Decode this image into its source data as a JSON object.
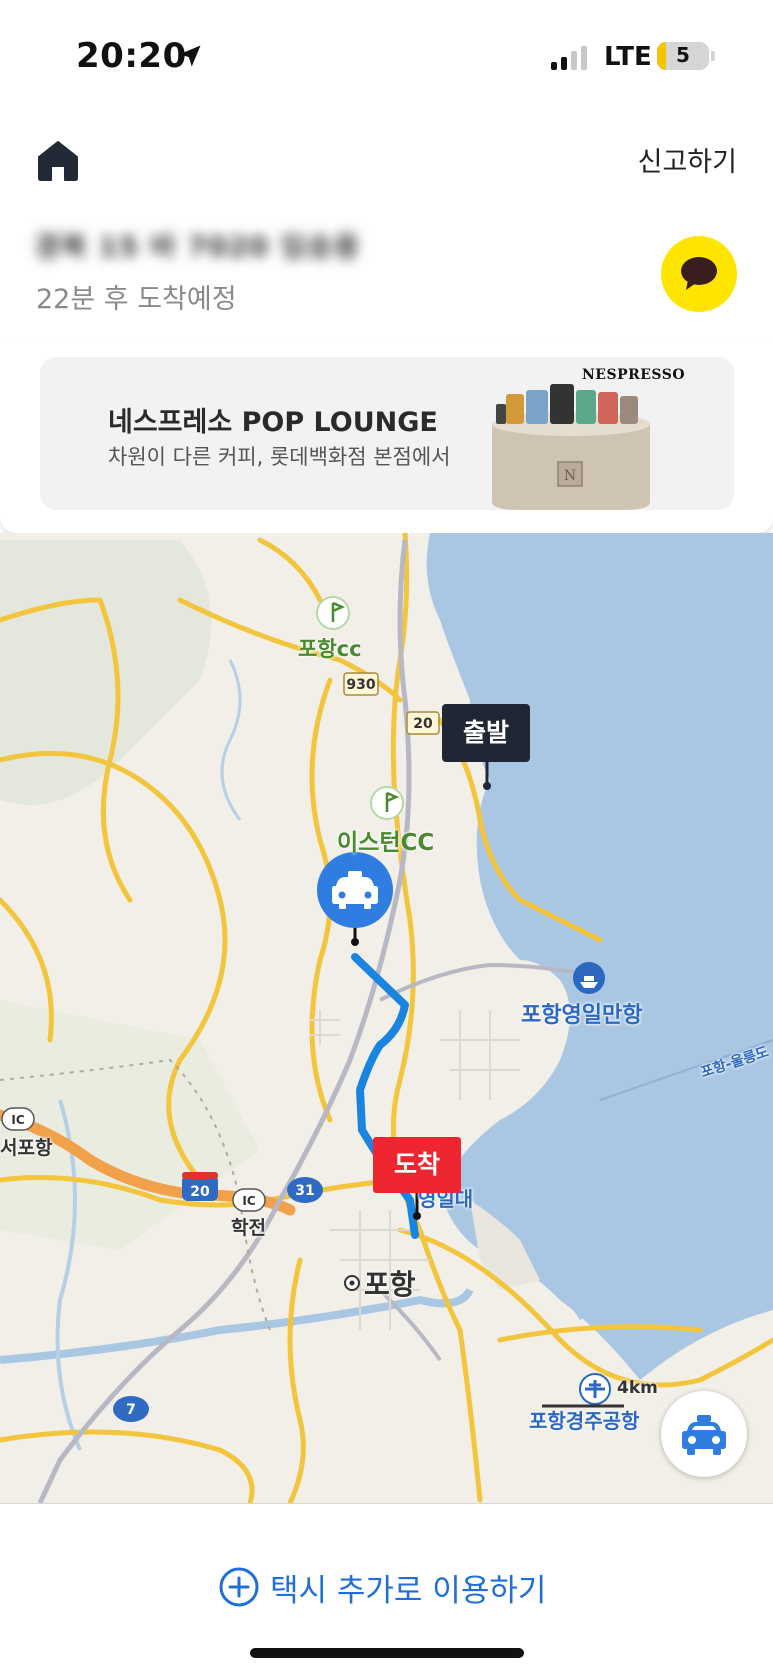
{
  "status_bar": {
    "time": "20:20",
    "network": "LTE",
    "battery": "5",
    "icons": [
      "location-arrow-icon",
      "signal-icon",
      "battery-icon"
    ]
  },
  "header": {
    "home_icon": "home-icon",
    "report_label": "신고하기",
    "car_info_blurred": "경북 15 바 7020 임승용",
    "eta_text": "22분 후 도착예정",
    "chat_icon": "kakao-chat-icon"
  },
  "ad": {
    "title": "네스프레소 POP LOUNGE",
    "subtitle": "차원이 다른 커피, 롯데백화점 본점에서",
    "brand": "NESPRESSO"
  },
  "map": {
    "labels": {
      "pohang_cc": "포항cc",
      "eastern_cc": "이스턴CC",
      "yeongil_port": "포항영일만항",
      "pohang": "포항",
      "seopohang": "서포항",
      "hakjeon": "학전",
      "airport": "포항경주공항",
      "route_text": "포항-울릉도",
      "yeongildae": "영일대",
      "scale": "4km"
    },
    "road_numbers": {
      "r930": "930",
      "r20": "20",
      "r20_highway": "20",
      "r31": "31",
      "r7": "7",
      "ic": "IC"
    },
    "start_marker": "출발",
    "end_marker": "도착",
    "colors": {
      "route": "#1a85e0",
      "start_marker": "#1f2634",
      "end_marker": "#ee2631",
      "sea": "#a9c7e3",
      "taxi_pin": "#2f7de1"
    }
  },
  "bottom": {
    "add_taxi_label": "택시 추가로 이용하기",
    "accent_color": "#1f6fd6"
  }
}
